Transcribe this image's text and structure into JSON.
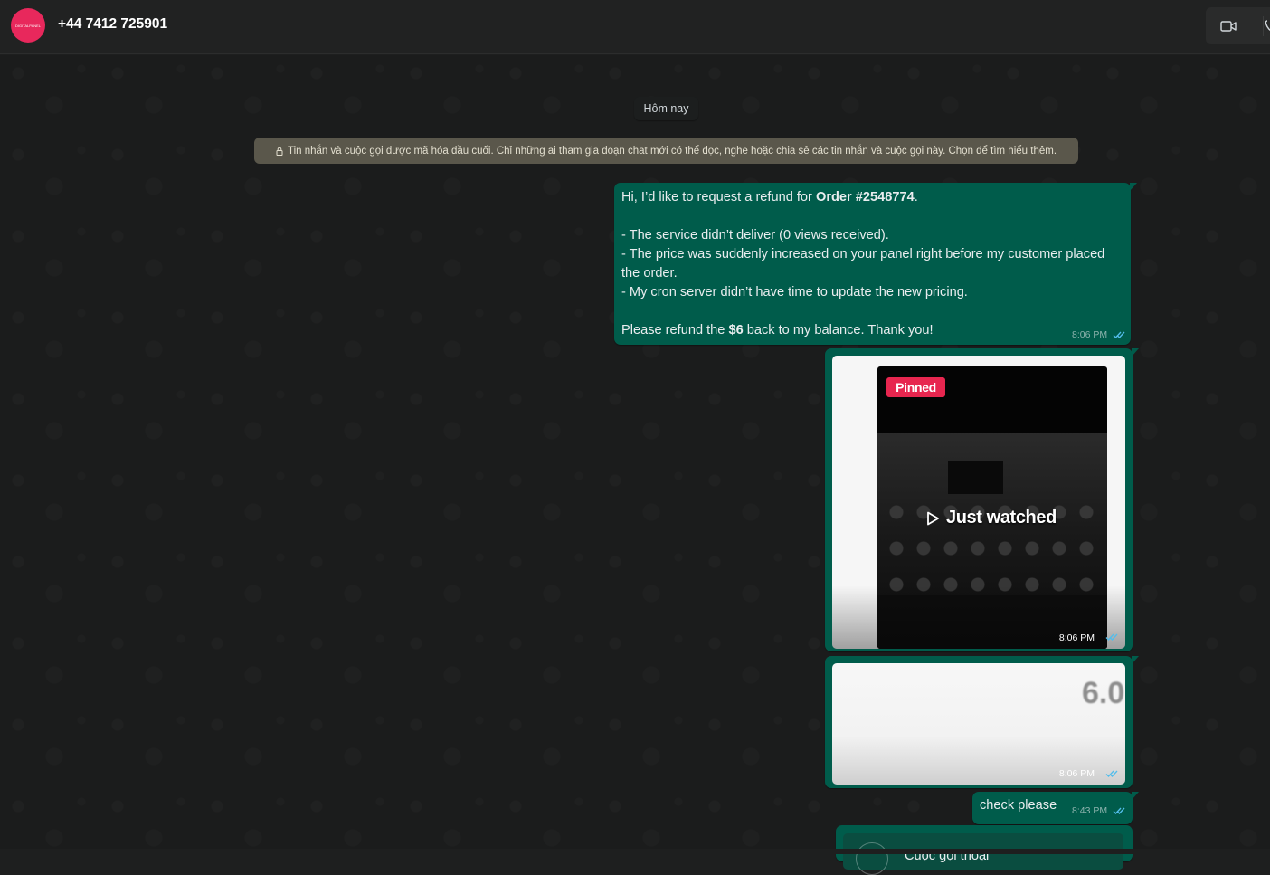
{
  "header": {
    "avatar_text": "DIGITALPANEL",
    "contact_name": "+44 7412 725901",
    "video_call_icon": "video-camera-icon",
    "voice_call_icon": "phone-icon"
  },
  "chat": {
    "date_chip": "Hôm nay",
    "encryption_notice": "Tin nhắn và cuộc gọi được mã hóa đầu cuối. Chỉ những ai tham gia đoạn chat mới có thể đọc, nghe hoặc chia sẻ các tin nhắn và cuộc gọi này. Chọn để tìm hiểu thêm.",
    "messages": [
      {
        "line1_prefix": "Hi, I’d like to request a refund for ",
        "line1_bold": "Order #2548774",
        "line1_suffix": ".",
        "line2": "- The service didn’t deliver (0 views received).",
        "line3": "- The price was suddenly increased on your panel right before my customer placed the order.",
        "line4": "- My cron server didn’t have time to update the new pricing.",
        "line5_prefix": "Please refund the ",
        "line5_bold": "$6",
        "line5_suffix": " back to my balance. Thank you!",
        "time": "8:06 PM",
        "status_icon": "double-check-read-icon"
      },
      {
        "type": "image",
        "pinned_label": "Pinned",
        "overlay_text": "Just watched",
        "play_icon": "play-icon",
        "time": "8:06 PM",
        "status_icon": "double-check-read-icon"
      },
      {
        "type": "image",
        "partial_value": "6.0",
        "time": "8:06 PM",
        "status_icon": "double-check-read-icon"
      },
      {
        "text": "check please",
        "time": "8:43 PM",
        "status_icon": "double-check-read-icon"
      },
      {
        "type": "call",
        "call_title": "Cuộc gọi thoại"
      }
    ]
  },
  "colors": {
    "outgoing_bubble": "#005c4b",
    "chat_background": "#1b1c1c",
    "avatar": "#e8285c",
    "read_ticks": "#53bdeb",
    "pinned_badge": "#e7264f"
  }
}
